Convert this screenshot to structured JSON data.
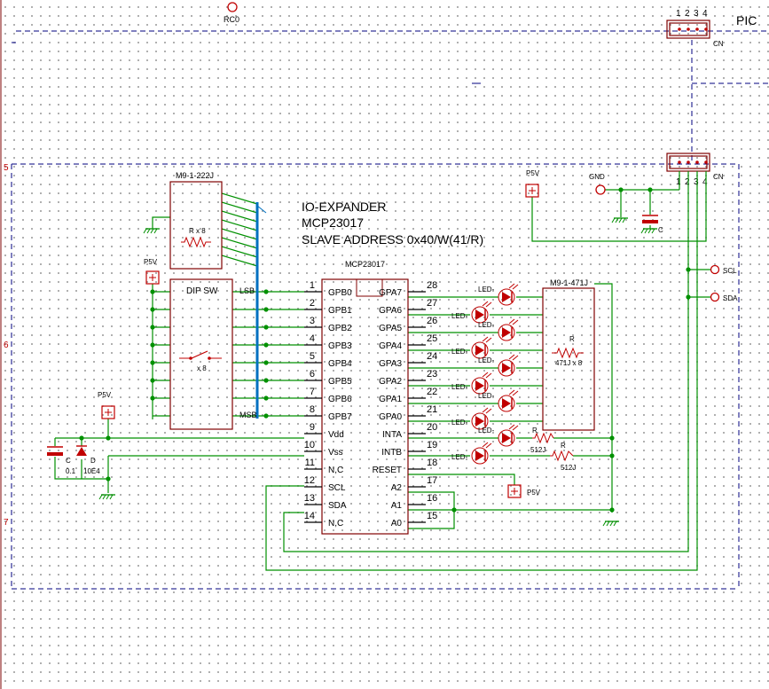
{
  "colors": {
    "wire": "#009000",
    "body": "#800000",
    "comp": "#c00000",
    "bus": "#0070c0",
    "frame": "#00007f",
    "pin": "#000000"
  },
  "title": {
    "line1": "IO-EXPANDER",
    "line2": "MCP23017",
    "line3": "SLAVE ADDRESS 0x40/W(41/R)"
  },
  "sheet": {
    "row5": "5",
    "row6": "6",
    "row7": "7",
    "pic_label": "PIC"
  },
  "top_connector": {
    "pins": [
      "1",
      "2",
      "3",
      "4"
    ],
    "ref": "CN",
    "rc0": "RC0"
  },
  "bus_connector": {
    "pins": [
      "1",
      "2",
      "3",
      "4"
    ],
    "ref": "CN",
    "gnd": "GND",
    "p5v": "P5V",
    "cap": "C"
  },
  "rpack_top": {
    "ref": "M9-1-222J",
    "value": "R x 8"
  },
  "dipsw": {
    "ref": "DIP SW",
    "count": "x 8",
    "lsb": "LSB",
    "msb": "MSB",
    "p5v": "P5V"
  },
  "chip": {
    "ref": "MCP23017",
    "left_pins": [
      {
        "num": "1",
        "name": "GPB0"
      },
      {
        "num": "2",
        "name": "GPB1"
      },
      {
        "num": "3",
        "name": "GPB2"
      },
      {
        "num": "4",
        "name": "GPB3"
      },
      {
        "num": "5",
        "name": "GPB4"
      },
      {
        "num": "6",
        "name": "GPB5"
      },
      {
        "num": "7",
        "name": "GPB6"
      },
      {
        "num": "8",
        "name": "GPB7"
      },
      {
        "num": "9",
        "name": "Vdd"
      },
      {
        "num": "10",
        "name": "Vss"
      },
      {
        "num": "11",
        "name": "N,C"
      },
      {
        "num": "12",
        "name": "SCL"
      },
      {
        "num": "13",
        "name": "SDA"
      },
      {
        "num": "14",
        "name": "N,C"
      }
    ],
    "right_pins": [
      {
        "num": "28",
        "name": "GPA7"
      },
      {
        "num": "27",
        "name": "GPA6"
      },
      {
        "num": "26",
        "name": "GPA5"
      },
      {
        "num": "25",
        "name": "GPA4"
      },
      {
        "num": "24",
        "name": "GPA3"
      },
      {
        "num": "23",
        "name": "GPA2"
      },
      {
        "num": "22",
        "name": "GPA1"
      },
      {
        "num": "21",
        "name": "GPA0"
      },
      {
        "num": "20",
        "name": "INTA"
      },
      {
        "num": "19",
        "name": "INTB"
      },
      {
        "num": "18",
        "name": "RESET"
      },
      {
        "num": "17",
        "name": "A2"
      },
      {
        "num": "16",
        "name": "A1"
      },
      {
        "num": "15",
        "name": "A0"
      }
    ]
  },
  "leds": {
    "label": "LED-",
    "count": 8
  },
  "rpack_right": {
    "ref": "M9-1-471J",
    "r": "R",
    "value": "471J x 8"
  },
  "int_resistors": {
    "r": "R",
    "value": "512J"
  },
  "decoupling": {
    "p5v": "P5V",
    "cap": "C",
    "cap_val": "0.1",
    "diode": "D",
    "diode_val": "10E4"
  },
  "reset_pull": {
    "p5v": "P5V"
  },
  "bus_out": {
    "scl": "SCL",
    "sda": "SDA"
  }
}
